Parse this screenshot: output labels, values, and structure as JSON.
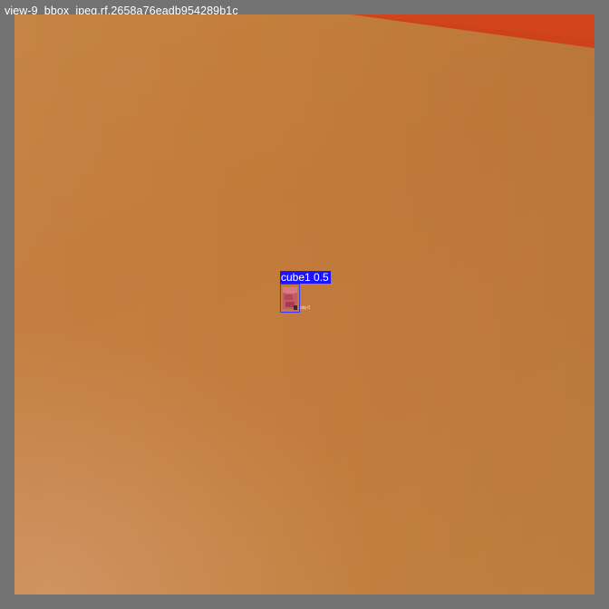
{
  "file": {
    "title": "view-9_bbox_jpeg.rf.2658a76eadb954289b1c"
  },
  "detection": {
    "label": "cube1 0.5",
    "marker_text": "obj-0"
  },
  "colors": {
    "frame": "#727272",
    "surface": "#c27b3a",
    "red_wedge": "#d2441c",
    "bbox_stroke": "#3b3bff",
    "label_bg": "#1a14ff",
    "cube": "#c65a66"
  },
  "icons": {
    "detected_object": "cube-icon"
  }
}
